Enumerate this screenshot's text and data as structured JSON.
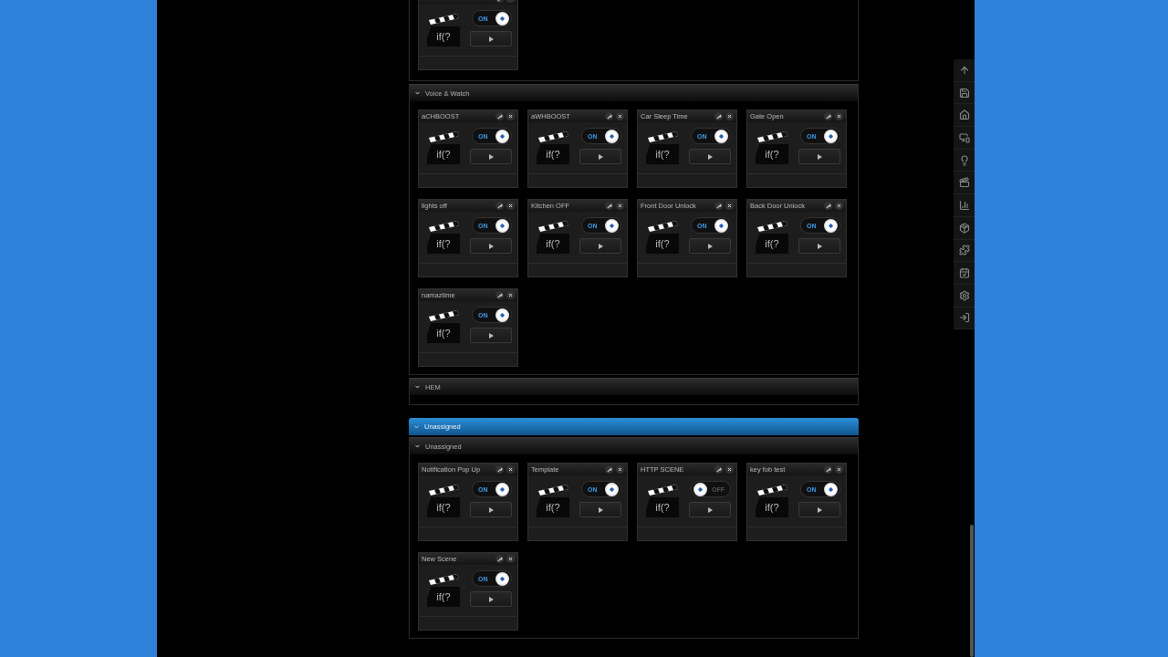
{
  "groups": [
    {
      "kind": "room",
      "scenes": [
        {
          "label": "ON",
          "on": true,
          "code": "if(?"
        }
      ]
    },
    {
      "kind": "room",
      "title": "Voice & Watch",
      "scenes": [
        {
          "title": "aCHBOOST",
          "label": "ON",
          "on": true,
          "code": "if(?"
        },
        {
          "title": "aWHBOOST",
          "label": "ON",
          "on": true,
          "code": "if(?"
        },
        {
          "title": "Car Sleep Time",
          "label": "ON",
          "on": true,
          "code": "if(?"
        },
        {
          "title": "Gate Open",
          "label": "ON",
          "on": true,
          "code": "if(?"
        },
        {
          "title": "lights off",
          "label": "ON",
          "on": true,
          "code": "if(?"
        },
        {
          "title": "Kitchen OFF",
          "label": "ON",
          "on": true,
          "code": "if(?"
        },
        {
          "title": "Front Door Unlock",
          "label": "ON",
          "on": true,
          "code": "if(?"
        },
        {
          "title": "Back Door Unlock",
          "label": "ON",
          "on": true,
          "code": "if(?"
        },
        {
          "title": "namaztime",
          "label": "ON",
          "on": true,
          "code": "if(?"
        }
      ]
    },
    {
      "kind": "room",
      "title": "HEM"
    },
    {
      "kind": "floor",
      "title": "Unassigned"
    },
    {
      "kind": "room",
      "title": "Unassigned",
      "scenes": [
        {
          "title": "Notification Pop Up",
          "label": "ON",
          "on": true,
          "code": "if(?"
        },
        {
          "title": "Template",
          "label": "ON",
          "on": true,
          "code": "if(?"
        },
        {
          "title": "HTTP SCENE",
          "label": "OFF",
          "on": false,
          "code": "if(?"
        },
        {
          "title": "key fob test",
          "label": "ON",
          "on": true,
          "code": "if(?"
        },
        {
          "title": "New Scene",
          "label": "ON",
          "on": true,
          "code": "if(?"
        }
      ]
    }
  ]
}
